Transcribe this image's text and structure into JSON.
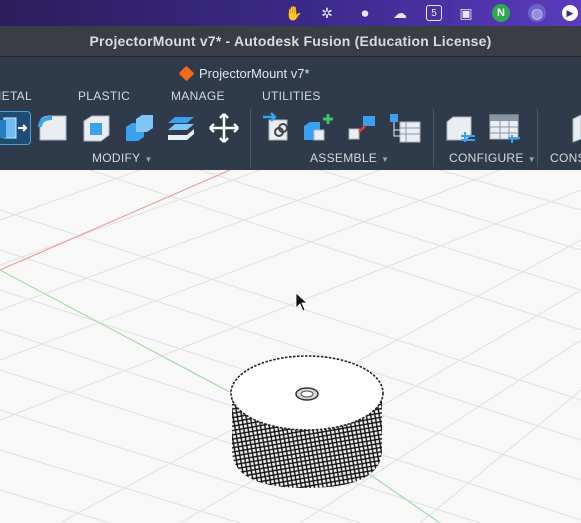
{
  "app": {
    "window_title": "ProjectorMount v7* - Autodesk Fusion (Education License)",
    "document_tab": "ProjectorMount v7*"
  },
  "menubar_icons": [
    {
      "name": "hand-icon",
      "glyph": "✋"
    },
    {
      "name": "snowflake-icon",
      "glyph": "✲"
    },
    {
      "name": "record-icon",
      "glyph": "⏺"
    },
    {
      "name": "cloud-icon",
      "glyph": "☁"
    },
    {
      "name": "calendar-icon",
      "glyph": "5"
    },
    {
      "name": "display-icon",
      "glyph": "▣"
    },
    {
      "name": "n-badge-icon",
      "glyph": "N"
    },
    {
      "name": "globe-icon",
      "glyph": "◍"
    },
    {
      "name": "play-icon",
      "glyph": "▶"
    }
  ],
  "toolbar": {
    "tabs": [
      "IETAL",
      "PLASTIC",
      "MANAGE",
      "UTILITIES"
    ],
    "groups": {
      "modify": "MODIFY",
      "assemble": "ASSEMBLE",
      "configure": "CONFIGURE",
      "construct": "CONS"
    }
  },
  "colors": {
    "toolbar_bg": "#2f3a4a",
    "accent_blue": "#3aa0f0",
    "green_plus": "#3cc46a",
    "orange_cube": "#f26b1d"
  }
}
